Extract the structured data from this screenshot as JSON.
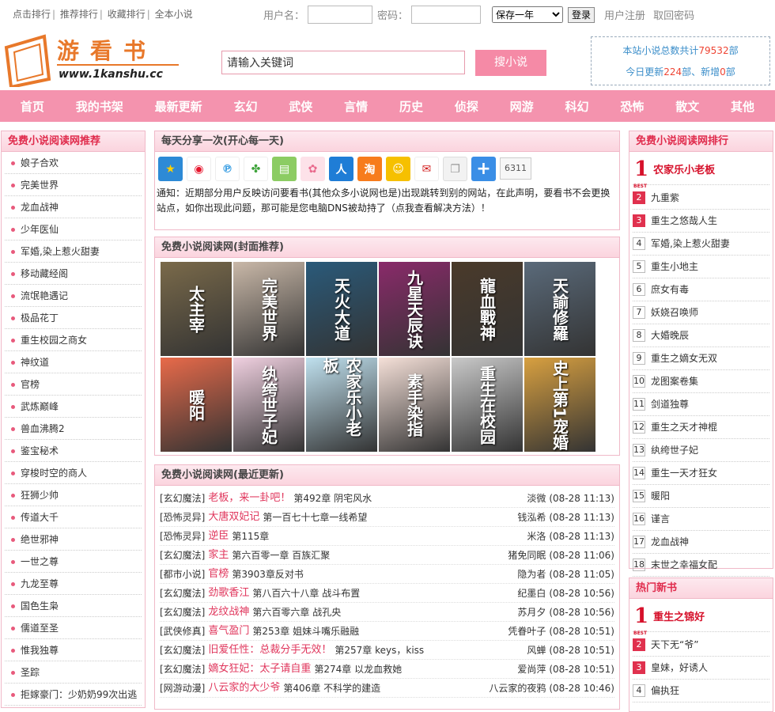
{
  "top": {
    "links": [
      "点击排行",
      "推荐排行",
      "收藏排行",
      "全本小说"
    ],
    "username_label": "用户名：",
    "password_label": "密码：",
    "remember": "保存一年",
    "login": "登录",
    "register": "用户注册",
    "forgot": "取回密码"
  },
  "logo": {
    "name": "游看书",
    "url": "www.1kanshu.cc"
  },
  "search": {
    "placeholder": "请输入关键词",
    "button": "搜小说"
  },
  "stats": {
    "line1_pre": "本站小说总数共计",
    "total": "79532",
    "unit1": "部",
    "line2_pre": "今日更新",
    "updated": "224",
    "mid": "部、新增",
    "added": "0",
    "unit2": "部"
  },
  "nav": [
    "首页",
    "我的书架",
    "最新更新",
    "玄幻",
    "武侠",
    "言情",
    "历史",
    "侦探",
    "网游",
    "科幻",
    "恐怖",
    "散文",
    "其他"
  ],
  "left": {
    "title": "免费小说阅读网推荐",
    "items": [
      "娘子合欢",
      "完美世界",
      "龙血战神",
      "少年医仙",
      "军婚,染上惹火甜妻",
      "移动藏经阁",
      "流氓艳遇记",
      "极品花丁",
      "重生校园之商女",
      "神纹道",
      "官榜",
      "武炼巅峰",
      "兽血沸腾2",
      "鉴宝秘术",
      "穿梭时空的商人",
      "狂狮少帅",
      "传道大千",
      "绝世邪神",
      "一世之尊",
      "九龙至尊",
      "国色生枭",
      "儒道至圣",
      "惟我独尊",
      "圣踪",
      "拒嫁豪门：少奶奶99次出逃"
    ]
  },
  "share": {
    "title": "每天分享一次(开心每一天)",
    "count": "6311",
    "icons": [
      "qzone-icon",
      "weibo-icon",
      "tencent-weibo-icon",
      "clover-icon",
      "kaixin-icon",
      "flower-icon",
      "renren-icon",
      "taobao-icon",
      "smile-icon",
      "netease-icon",
      "copy-icon",
      "plus-icon"
    ],
    "notice": "通知：近期部分用户反映访问要看书(其他众多小说网也是)出现跳转到别的网站，在此声明，要看书不会更换站点，如你出现此问题，那可能是您电脑DNS被劫持了（点我查看解决方法）！"
  },
  "covers": {
    "title": "免费小说阅读网(封面推荐)",
    "books": [
      "太主宰",
      "完美世界",
      "天火大道",
      "九星天辰诀",
      "龍血戰神",
      "天諭修羅",
      "暖阳",
      "纨绔世子妃",
      "农家乐小老板",
      "素手染指",
      "重生在校园",
      "史上第1宠婚"
    ]
  },
  "updates": {
    "title": "免费小说阅读网(最近更新)",
    "rows": [
      {
        "cat": "[玄幻魔法]",
        "title": "老板，来一卦吧！",
        "chapter": "第492章 阴宅风水",
        "author": "淡微",
        "date": "(08-28 11:13)"
      },
      {
        "cat": "[恐怖灵异]",
        "title": "大唐双妃记",
        "chapter": "第一百七十七章一线希望",
        "author": "钱泓希",
        "date": "(08-28 11:13)"
      },
      {
        "cat": "[恐怖灵异]",
        "title": "逆臣",
        "chapter": "第115章",
        "author": "米洛",
        "date": "(08-28 11:13)"
      },
      {
        "cat": "[玄幻魔法]",
        "title": "家主",
        "chapter": "第六百零一章 百族汇聚",
        "author": "猪免同眠",
        "date": "(08-28 11:06)"
      },
      {
        "cat": "[都市小说]",
        "title": "官榜",
        "chapter": "第3903章反对书",
        "author": "隐为者",
        "date": "(08-28 11:05)"
      },
      {
        "cat": "[玄幻魔法]",
        "title": "劲歌香江",
        "chapter": "第八百六十八章 战斗布置",
        "author": "纪墨白",
        "date": "(08-28 10:56)"
      },
      {
        "cat": "[玄幻魔法]",
        "title": "龙纹战神",
        "chapter": "第六百零六章 战孔央",
        "author": "苏月夕",
        "date": "(08-28 10:56)"
      },
      {
        "cat": "[武侠修真]",
        "title": "喜气盈门",
        "chapter": "第253章 姐妹斗嘴乐融融",
        "author": "凭眷叶子",
        "date": "(08-28 10:51)"
      },
      {
        "cat": "[玄幻魔法]",
        "title": "旧爱任性：总裁分手无效！",
        "chapter": "第257章 keys，kiss",
        "author": "风蝉",
        "date": "(08-28 10:51)"
      },
      {
        "cat": "[玄幻魔法]",
        "title": "嫡女狂妃：太子请自重",
        "chapter": "第274章 以龙血救她",
        "author": "爱尚萍",
        "date": "(08-28 10:51)"
      },
      {
        "cat": "[网游动漫]",
        "title": "八云家的大少爷",
        "chapter": "第406章 不科学的建造",
        "author": "八云家的夜鸦",
        "date": "(08-28 10:46)"
      }
    ]
  },
  "rank": {
    "title": "免费小说阅读网排行",
    "first": "农家乐小老板",
    "items": [
      "九重紫",
      "重生之悠哉人生",
      "军婚,染上惹火甜妻",
      "重生小地主",
      "庶女有毒",
      "妖娆召唤师",
      "大婚晚辰",
      "重生之嫡女无双",
      "龙图案卷集",
      "剑道独尊",
      "重生之天才神棍",
      "纨绔世子妃",
      "重生一天才狂女",
      "暖阳",
      "谨言",
      "龙血战神",
      "末世之幸福女配"
    ]
  },
  "hot": {
    "title": "热门新书",
    "first": "重生之锦好",
    "items": [
      "天下无“爷”",
      "皇妹，好诱人",
      "偏执狂"
    ]
  }
}
